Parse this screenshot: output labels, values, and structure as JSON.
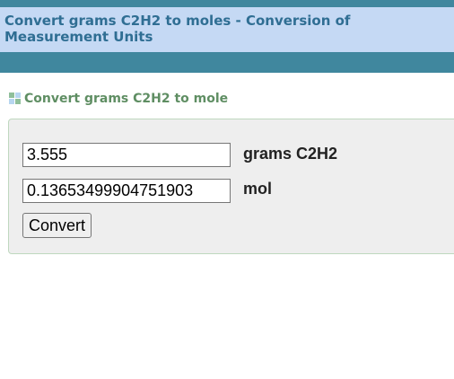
{
  "page": {
    "title": "Convert grams C2H2 to moles - Conversion of Measurement Units"
  },
  "section": {
    "icon": "grid-icon",
    "heading": "Convert grams C2H2 to mole"
  },
  "converter": {
    "grams_value": "3.555",
    "grams_unit": "grams C2H2",
    "mol_value": "0.13653499904751903",
    "mol_unit": "mol",
    "convert_label": "Convert"
  },
  "colors": {
    "header_bar": "#40879e",
    "title_band": "#c5d9f4",
    "title_text": "#2f6e93",
    "section_heading": "#5f8e63",
    "box_background": "#eeeeee",
    "box_border": "#bfd8bf"
  }
}
